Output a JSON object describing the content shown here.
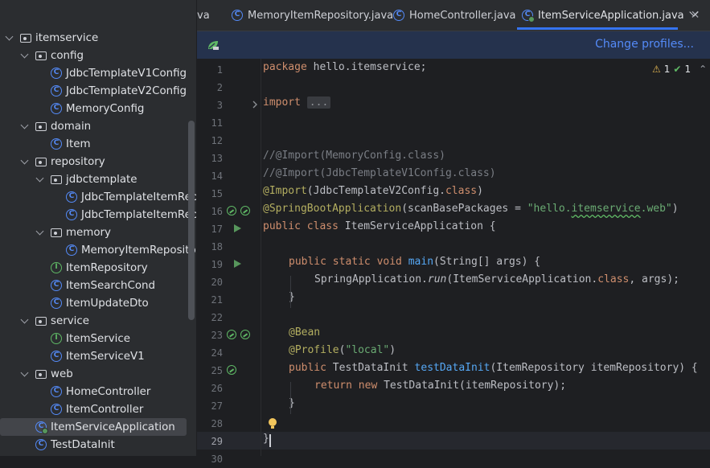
{
  "project_tree": [
    {
      "label": "itemservice",
      "type": "folder",
      "depth": 0,
      "expanded": true
    },
    {
      "label": "config",
      "type": "folder",
      "depth": 1,
      "expanded": true
    },
    {
      "label": "JdbcTemplateV1Config",
      "type": "class",
      "depth": 2
    },
    {
      "label": "JdbcTemplateV2Config",
      "type": "class",
      "depth": 2
    },
    {
      "label": "MemoryConfig",
      "type": "class",
      "depth": 2
    },
    {
      "label": "domain",
      "type": "folder",
      "depth": 1,
      "expanded": true
    },
    {
      "label": "Item",
      "type": "class",
      "depth": 2
    },
    {
      "label": "repository",
      "type": "folder",
      "depth": 1,
      "expanded": true
    },
    {
      "label": "jdbctemplate",
      "type": "folder",
      "depth": 2,
      "expanded": true
    },
    {
      "label": "JdbcTemplateItemRepo",
      "type": "class",
      "depth": 3
    },
    {
      "label": "JdbcTemplateItemRepo",
      "type": "class",
      "depth": 3
    },
    {
      "label": "memory",
      "type": "folder",
      "depth": 2,
      "expanded": true
    },
    {
      "label": "MemoryItemRepository",
      "type": "class",
      "depth": 3
    },
    {
      "label": "ItemRepository",
      "type": "interface",
      "depth": 2
    },
    {
      "label": "ItemSearchCond",
      "type": "class",
      "depth": 2
    },
    {
      "label": "ItemUpdateDto",
      "type": "class",
      "depth": 2
    },
    {
      "label": "service",
      "type": "folder",
      "depth": 1,
      "expanded": true
    },
    {
      "label": "ItemService",
      "type": "interface",
      "depth": 2
    },
    {
      "label": "ItemServiceV1",
      "type": "class",
      "depth": 2
    },
    {
      "label": "web",
      "type": "folder",
      "depth": 1,
      "expanded": true
    },
    {
      "label": "HomeController",
      "type": "class",
      "depth": 2
    },
    {
      "label": "ItemController",
      "type": "class",
      "depth": 2
    },
    {
      "label": "ItemServiceApplication",
      "type": "app",
      "depth": 1,
      "selected": true
    },
    {
      "label": "TestDataInit",
      "type": "class",
      "depth": 1
    }
  ],
  "tabs": [
    {
      "label": "va",
      "partial": true
    },
    {
      "label": "MemoryItemRepository.java"
    },
    {
      "label": "HomeController.java"
    },
    {
      "label": "ItemServiceApplication.java",
      "active": true
    }
  ],
  "banner": {
    "link_label": "Change profiles..."
  },
  "inspections": {
    "warnings": "1",
    "ok": "1"
  },
  "line_numbers": [
    "1",
    "2",
    "3",
    "11",
    "12",
    "13",
    "14",
    "15",
    "16",
    "17",
    "18",
    "19",
    "20",
    "21",
    "22",
    "23",
    "24",
    "25",
    "26",
    "27",
    "28",
    "29",
    "30"
  ],
  "code": {
    "l1_kw": "package",
    "l1_rest": " hello.itemservice;",
    "l3_kw": "import",
    "l3_fold": "...",
    "l13": "//@Import(MemoryConfig.class)",
    "l14": "//@Import(JdbcTemplateV1Config.class)",
    "l15_an": "@Import",
    "l15_a": "(JdbcTemplateV2Config.",
    "l15_kw": "class",
    "l15_b": ")",
    "l16_an": "@SpringBootApplication",
    "l16_a": "(scanBasePackages = ",
    "l16_s1": "\"hello.",
    "l16_s2": "itemservice",
    "l16_s3": ".web\"",
    "l16_b": ")",
    "l17_kw": "public class",
    "l17_rest": " ItemServiceApplication {",
    "l19_kw": "public static void",
    "l19_fn": "main",
    "l19_rest": "(String[] args) {",
    "l20_a": "SpringApplication.",
    "l20_it": "run",
    "l20_b": "(ItemServiceApplication.",
    "l20_kw": "class",
    "l20_c": ", args);",
    "l21": "}",
    "l23": "@Bean",
    "l24_an": "@Profile",
    "l24_a": "(",
    "l24_s": "\"local\"",
    "l24_b": ")",
    "l25_kw": "public",
    "l25_a": " TestDataInit ",
    "l25_fn": "testDataInit",
    "l25_b": "(ItemRepository itemRepository) {",
    "l26_kw": "return new",
    "l26_rest": " TestDataInit(itemRepository);",
    "l27": "}",
    "l29": "}"
  }
}
